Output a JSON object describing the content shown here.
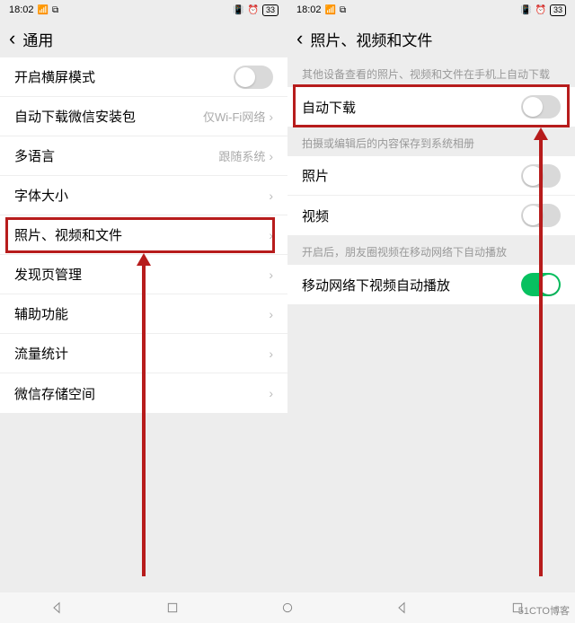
{
  "statusbar": {
    "time": "18:02",
    "battery": "33"
  },
  "left": {
    "title": "通用",
    "rows": {
      "landscape": "开启横屏模式",
      "autodl_pkg": "自动下载微信安装包",
      "autodl_pkg_val": "仅Wi-Fi网络",
      "lang": "多语言",
      "lang_val": "跟随系统",
      "font": "字体大小",
      "pvf": "照片、视频和文件",
      "discover": "发现页管理",
      "access": "辅助功能",
      "traffic": "流量统计",
      "storage": "微信存储空间"
    }
  },
  "right": {
    "title": "照片、视频和文件",
    "hints": {
      "a": "其他设备查看的照片、视频和文件在手机上自动下载",
      "b": "拍摄或编辑后的内容保存到系统相册",
      "c": "开启后，朋友圈视频在移动网络下自动播放"
    },
    "rows": {
      "autodl": "自动下载",
      "photo": "照片",
      "video": "视频",
      "autoplay": "移动网络下视频自动播放"
    }
  },
  "watermark": "51CTO博客"
}
